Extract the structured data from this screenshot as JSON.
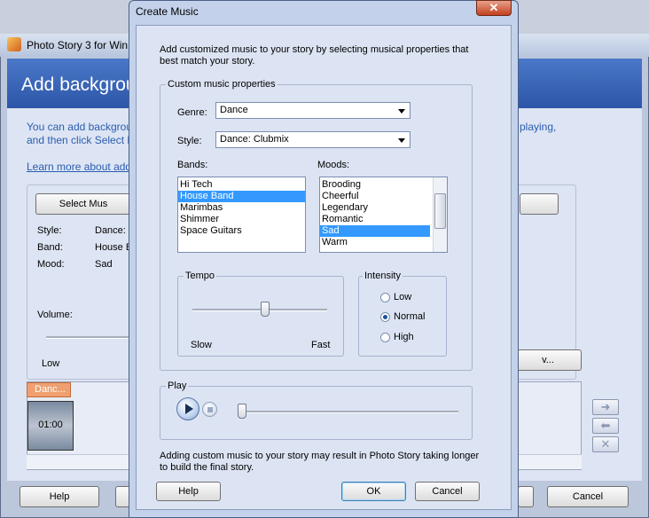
{
  "background_window": {
    "title": "Photo Story 3 for Win",
    "header": "Add backgrou",
    "description_line1": "You can add backgrou",
    "description_line1_right": "playing,",
    "description_line2": "and then click Select M",
    "learn_more": "Learn more about add",
    "select_music_button": "Select Mus",
    "style_label": "Style:",
    "style_value": "Dance:",
    "band_label": "Band:",
    "band_value": "House B",
    "mood_label": "Mood:",
    "mood_value": "Sad",
    "volume_label": "Volume:",
    "volume_low": "Low",
    "right_button": "v...",
    "music_track": "Danc...",
    "thumb_time": "01:00",
    "help_button": "Help",
    "cancel_button": "Cancel"
  },
  "dialog": {
    "title": "Create Music",
    "intro_line1": "Add customized music to your story by selecting musical properties that",
    "intro_line2": "best match your story.",
    "group_label": "Custom music properties",
    "genre_label": "Genre:",
    "genre_value": "Dance",
    "style_label": "Style:",
    "style_value": "Dance: Clubmix",
    "bands_label": "Bands:",
    "bands": [
      "Hi Tech",
      "House Band",
      "Marimbas",
      "Shimmer",
      "Space Guitars"
    ],
    "selected_band": "House Band",
    "moods_label": "Moods:",
    "moods": [
      "Brooding",
      "Cheerful",
      "Legendary",
      "Romantic",
      "Sad",
      "Warm"
    ],
    "selected_mood": "Sad",
    "tempo_label": "Tempo",
    "tempo_slow": "Slow",
    "tempo_fast": "Fast",
    "intensity_label": "Intensity",
    "intensity_options": [
      "Low",
      "Normal",
      "High"
    ],
    "intensity_selected": "Normal",
    "play_label": "Play",
    "note_line1": "Adding custom music to your story may result in Photo Story taking longer",
    "note_line2": "to build the final story.",
    "help_button": "Help",
    "ok_button": "OK",
    "cancel_button": "Cancel"
  }
}
